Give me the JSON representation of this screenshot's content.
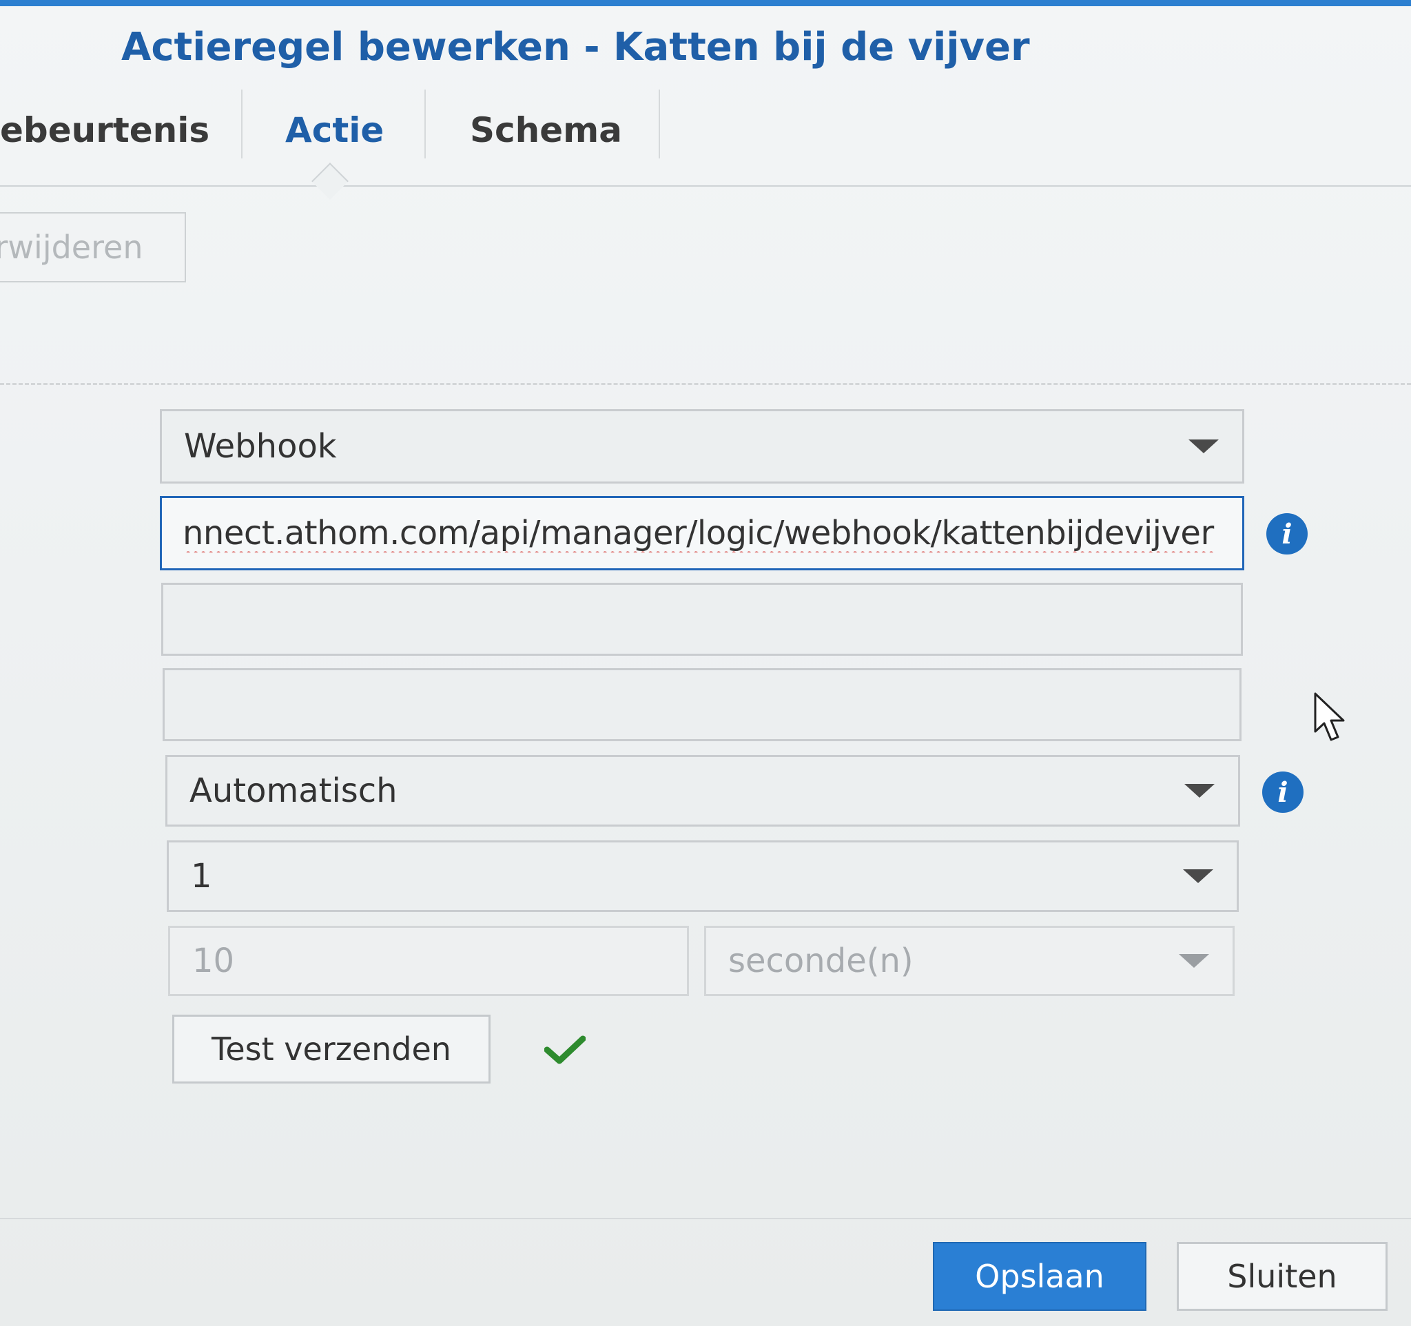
{
  "dialog": {
    "title": "Actieregel bewerken - Katten bij de vijver"
  },
  "tabs": [
    {
      "label": "ebeurtenis",
      "active": false
    },
    {
      "label": "Actie",
      "active": true
    },
    {
      "label": "Schema",
      "active": false
    }
  ],
  "toolbar": {
    "delete_label": "rwijderen"
  },
  "form": {
    "action_type": "Webhook",
    "url_value": "nnect.athom.com/api/manager/logic/webhook/kattenbijdevijver",
    "field3_value": "",
    "field4_value": "",
    "method": "Automatisch",
    "repeat": "1",
    "interval_value": "10",
    "interval_unit": "seconde(n)",
    "test_label": "Test verzenden"
  },
  "footer": {
    "save_label": "Opslaan",
    "close_label": "Sluiten"
  },
  "icons": {
    "info": "info-icon",
    "check": "check-icon",
    "dropdown": "chevron-down-icon",
    "cursor": "mouse-pointer-icon"
  },
  "colors": {
    "accent": "#2a7fd4",
    "title": "#1f5fa8",
    "success": "#2e8b2e"
  }
}
